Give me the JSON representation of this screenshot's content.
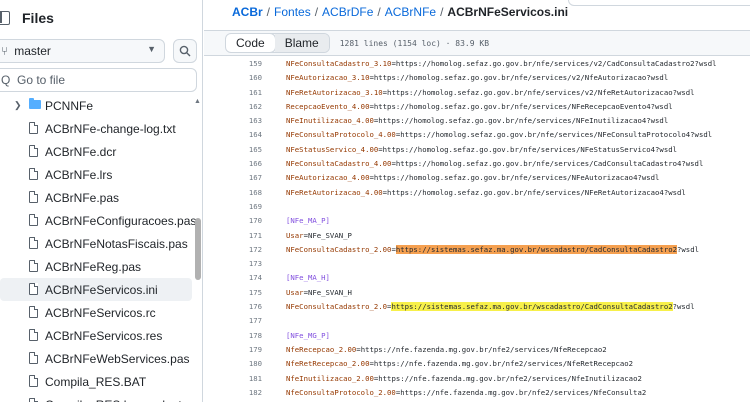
{
  "sidebar": {
    "title": "Files",
    "branch": "master",
    "goto_placeholder": "Go to file",
    "items": [
      {
        "name": "PCNNFe",
        "type": "folder"
      },
      {
        "name": "ACBrNFe-change-log.txt",
        "type": "file"
      },
      {
        "name": "ACBrNFe.dcr",
        "type": "file"
      },
      {
        "name": "ACBrNFe.lrs",
        "type": "file"
      },
      {
        "name": "ACBrNFe.pas",
        "type": "file"
      },
      {
        "name": "ACBrNFeConfiguracoes.pas",
        "type": "file"
      },
      {
        "name": "ACBrNFeNotasFiscais.pas",
        "type": "file"
      },
      {
        "name": "ACBrNFeReg.pas",
        "type": "file"
      },
      {
        "name": "ACBrNFeServicos.ini",
        "type": "file",
        "selected": true
      },
      {
        "name": "ACBrNFeServicos.rc",
        "type": "file"
      },
      {
        "name": "ACBrNFeServicos.res",
        "type": "file"
      },
      {
        "name": "ACBrNFeWebServices.pas",
        "type": "file"
      },
      {
        "name": "Compila_RES.BAT",
        "type": "file"
      },
      {
        "name": "Compila_RES.bsrc.selent",
        "type": "file"
      }
    ]
  },
  "breadcrumb": {
    "root": "ACBr",
    "parts": [
      "Fontes",
      "ACBrDFe",
      "ACBrNFe"
    ],
    "current": "ACBrNFeServicos.ini"
  },
  "toolbar": {
    "code_tab": "Code",
    "blame_tab": "Blame",
    "file_meta": "1281 lines (1154 loc) · 83.9 KB"
  },
  "code_lines": [
    {
      "n": "159",
      "key": "NFeConsultaCadastro_3.10",
      "val": "=https://homolog.sefaz.go.gov.br/nfe/services/v2/CadConsultaCadastro2?wsdl"
    },
    {
      "n": "160",
      "key": "NFeAutorizacao_3.10",
      "val": "=https://homolog.sefaz.go.gov.br/nfe/services/v2/NfeAutorizacao?wsdl"
    },
    {
      "n": "161",
      "key": "NFeRetAutorizacao_3.10",
      "val": "=https://homolog.sefaz.go.gov.br/nfe/services/v2/NfeRetAutorizacao?wsdl"
    },
    {
      "n": "162",
      "key": "RecepcaoEvento_4.00",
      "val": "=https://homolog.sefaz.go.gov.br/nfe/services/NFeRecepcaoEvento4?wsdl"
    },
    {
      "n": "163",
      "key": "NFeInutilizacao_4.00",
      "val": "=https://homolog.sefaz.go.gov.br/nfe/services/NFeInutilizacao4?wsdl"
    },
    {
      "n": "164",
      "key": "NFeConsultaProtocolo_4.00",
      "val": "=https://homolog.sefaz.go.gov.br/nfe/services/NFeConsultaProtocolo4?wsdl"
    },
    {
      "n": "165",
      "key": "NFeStatusServico_4.00",
      "val": "=https://homolog.sefaz.go.gov.br/nfe/services/NFeStatusServico4?wsdl"
    },
    {
      "n": "166",
      "key": "NFeConsultaCadastro_4.00",
      "val": "=https://homolog.sefaz.go.gov.br/nfe/services/CadConsultaCadastro4?wsdl"
    },
    {
      "n": "167",
      "key": "NFeAutorizacao_4.00",
      "val": "=https://homolog.sefaz.go.gov.br/nfe/services/NFeAutorizacao4?wsdl"
    },
    {
      "n": "168",
      "key": "NFeRetAutorizacao_4.00",
      "val": "=https://homolog.sefaz.go.gov.br/nfe/services/NFeRetAutorizacao4?wsdl"
    },
    {
      "n": "169"
    },
    {
      "n": "170",
      "section": "[NFe_MA_P]"
    },
    {
      "n": "171",
      "key": "Usar",
      "val": "=NFe_SVAN_P"
    },
    {
      "n": "172",
      "key": "NFeConsultaCadastro_2.00",
      "val": "=",
      "hl": "https://sistemas.sefaz.ma.gov.br/wscadastro/CadConsultaCadastro2",
      "hl_color": "orange",
      "rest": "?wsdl"
    },
    {
      "n": "173"
    },
    {
      "n": "174",
      "section": "[NFe_MA_H]"
    },
    {
      "n": "175",
      "key": "Usar",
      "val": "=NFe_SVAN_H"
    },
    {
      "n": "176",
      "key": "NFeConsultaCadastro_2.0",
      "val": "=",
      "hl": "https://sistemas.sefaz.ma.gov.br/wscadastro/CadConsultaCadastro2",
      "hl_color": "yellow",
      "rest": "?wsdl"
    },
    {
      "n": "177"
    },
    {
      "n": "178",
      "section": "[NFe_MG_P]"
    },
    {
      "n": "179",
      "key": "NfeRecepcao_2.00",
      "val": "=https://nfe.fazenda.mg.gov.br/nfe2/services/NfeRecepcao2"
    },
    {
      "n": "180",
      "key": "NfeRetRecepcao_2.00",
      "val": "=https://nfe.fazenda.mg.gov.br/nfe2/services/NfeRetRecepcao2"
    },
    {
      "n": "181",
      "key": "NfeInutilizacao_2.00",
      "val": "=https://nfe.fazenda.mg.gov.br/nfe2/services/NfeInutilizacao2"
    },
    {
      "n": "182",
      "key": "NfeConsultaProtocolo_2.00",
      "val": "=https://nfe.fazenda.mg.gov.br/nfe2/services/NfeConsulta2"
    },
    {
      "n": "183",
      "key": "NfeStatusServico_2.00",
      "val": "=https://nfe.fazenda.mg.gov.br/nfe2/services/NfeStatus2"
    }
  ]
}
